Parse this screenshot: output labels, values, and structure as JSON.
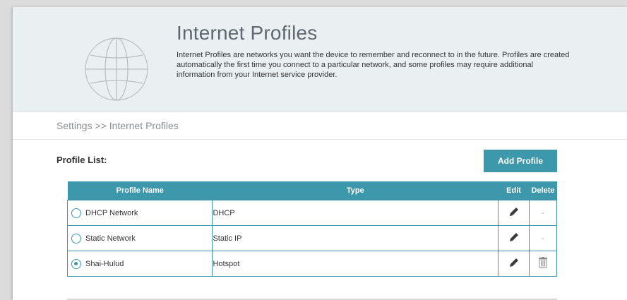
{
  "header": {
    "title": "Internet Profiles",
    "description": "Internet Profiles are networks you want the device to remember and reconnect to in the future. Profiles are created automatically the first time you connect to a particular network, and some profiles may require additional information from your Internet service provider.",
    "icon": "globe-icon"
  },
  "breadcrumb": "Settings >> Internet Profiles",
  "profile_list": {
    "label": "Profile List:",
    "add_button": "Add Profile",
    "columns": [
      "Profile Name",
      "Type",
      "Edit",
      "Delete"
    ],
    "rows": [
      {
        "name": "DHCP Network",
        "type": "DHCP",
        "selected": false,
        "delete": "-"
      },
      {
        "name": "Static Network",
        "type": "Static IP",
        "selected": false,
        "delete": "-"
      },
      {
        "name": "Shai-Hulud",
        "type": "Hotspot",
        "selected": true,
        "delete": "trash-icon"
      }
    ]
  },
  "colors": {
    "accent": "#3d98ab",
    "header_bg": "#eaf0f1"
  }
}
